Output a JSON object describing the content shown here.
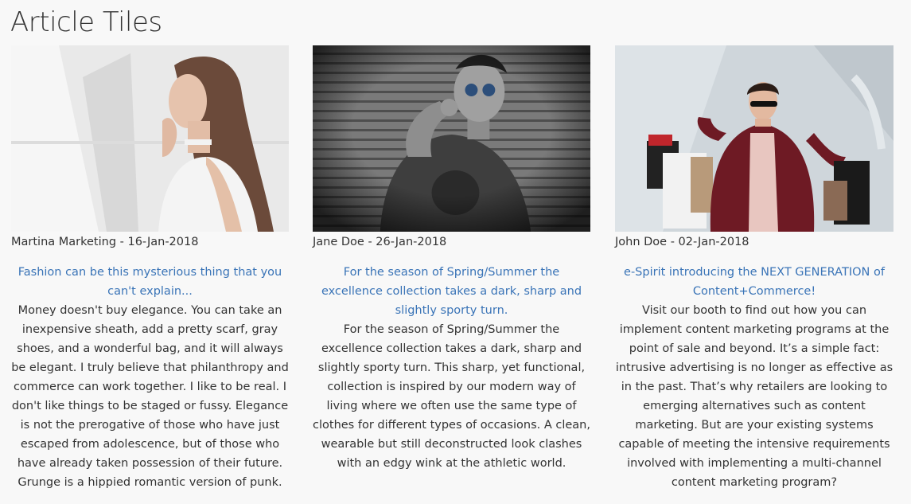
{
  "page": {
    "title": "Article Tiles"
  },
  "tiles": [
    {
      "meta": "Martina Marketing - 16-Jan-2018",
      "headline": "Fashion can be this mysterious thing that you can't explain...",
      "body": "Money doesn't buy elegance. You can take an inexpensive sheath, add a pretty scarf, gray shoes, and a wonderful bag, and it will always be elegant. I truly believe that philanthropy and commerce can work together. I like to be real. I don't like things to be staged or fussy. Elegance is not the prerogative of those who have just escaped from adolescence, but of those who have already taken possession of their future. Grunge is a hippied romantic version of punk."
    },
    {
      "meta": "Jane Doe - 26-Jan-2018",
      "headline": "For the season of Spring/Summer the excellence collection takes a dark, sharp and slightly sporty turn.",
      "body": "For the season of Spring/Summer the excellence collection takes a dark, sharp and slightly sporty turn. This sharp, yet functional, collection is inspired by our modern way of living where we often use the same type of clothes for different types of occasions. A clean, wearable but still deconstructed look clashes with an edgy wink at the athletic world."
    },
    {
      "meta": "John Doe - 02-Jan-2018",
      "headline": "e-Spirit introducing the NEXT GENERATION of Content+Commerce!",
      "body": "Visit our booth to find out how you can implement content marketing programs at the point of sale and beyond. It’s a simple fact: intrusive advertising is no longer as effective as in the past. That’s why retailers are looking to emerging alternatives such as content marketing. But are your existing systems capable of meeting the intensive requirements involved with implementing a multi-channel content marketing program?"
    }
  ],
  "colors": {
    "background": "#f8f8f8",
    "text": "#333333",
    "link": "#3a74b7"
  }
}
